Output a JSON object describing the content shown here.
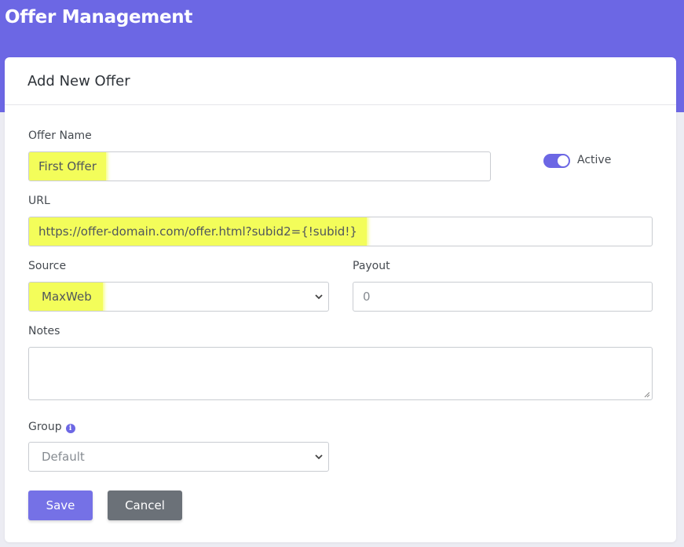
{
  "header": {
    "title": "Offer Management"
  },
  "card": {
    "title": "Add New Offer"
  },
  "form": {
    "offer_name": {
      "label": "Offer Name",
      "value": "First Offer"
    },
    "active": {
      "label": "Active",
      "checked": true
    },
    "url": {
      "label": "URL",
      "value": "https://offer-domain.com/offer.html?subid2={!subid!}"
    },
    "source": {
      "label": "Source",
      "selected": "MaxWeb"
    },
    "payout": {
      "label": "Payout",
      "placeholder": "0"
    },
    "notes": {
      "label": "Notes",
      "value": ""
    },
    "group": {
      "label": "Group",
      "selected": "Default",
      "info_icon": "info-icon"
    }
  },
  "actions": {
    "save_label": "Save",
    "cancel_label": "Cancel"
  },
  "colors": {
    "accent": "#6c67e4",
    "highlight": "#f3fd5a",
    "cancel": "#6b7178"
  }
}
